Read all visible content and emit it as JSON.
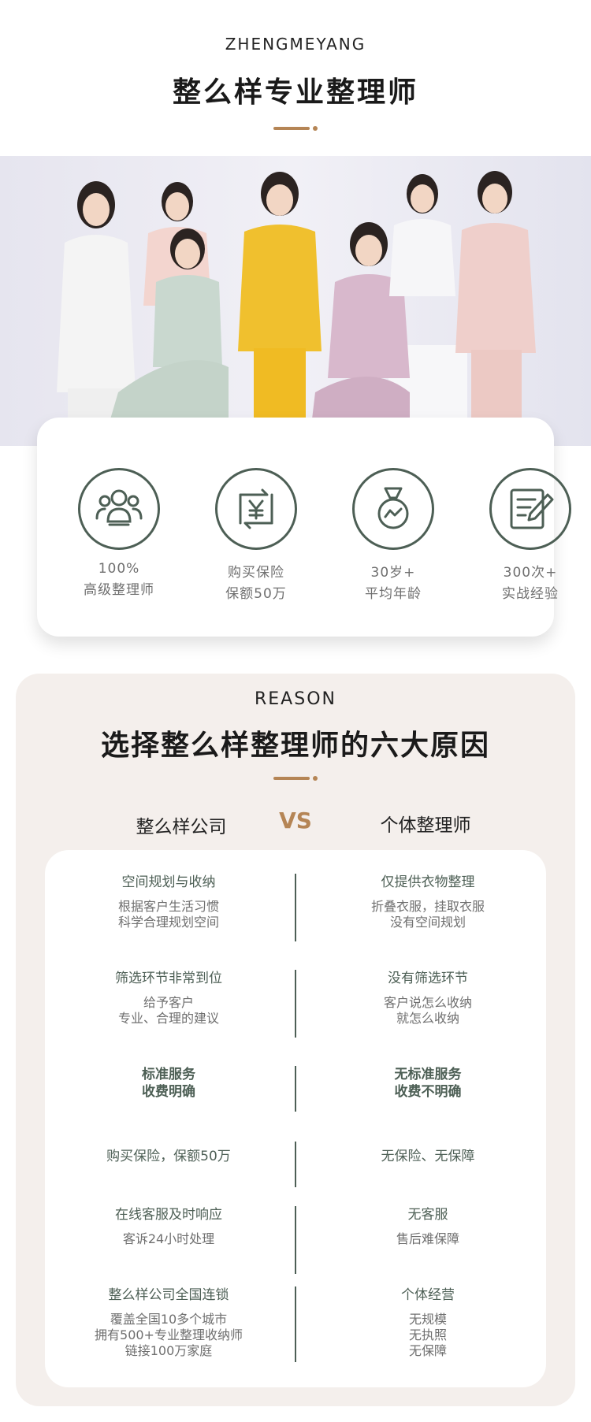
{
  "header": {
    "eyebrow": "ZHENGMEYANG",
    "title": "整么样专业整理师"
  },
  "colors": {
    "accent": "#b58555",
    "icon_green": "#4d5f55",
    "section_bg": "#f4efec"
  },
  "photo": {
    "description_icon": "team-photo"
  },
  "stats": [
    {
      "icon": "people-icon",
      "line1": "100%",
      "line2": "高级整理师"
    },
    {
      "icon": "yuan-exchange-icon",
      "line1": "购买保险",
      "line2": "保额50万"
    },
    {
      "icon": "medal-icon",
      "line1": "30岁+",
      "line2": "平均年龄"
    },
    {
      "icon": "notepad-pen-icon",
      "line1": "300次+",
      "line2": "实战经验"
    }
  ],
  "reason": {
    "eyebrow": "REASON",
    "title": "选择整么样整理师的六大原因",
    "left_label": "整么样公司",
    "vs": "VS",
    "right_label": "个体整理师",
    "rows": [
      {
        "left_title": "空间规划与收纳",
        "left_desc": [
          "根据客户生活习惯",
          "科学合理规划空间"
        ],
        "right_title": "仅提供衣物整理",
        "right_desc": [
          "折叠衣服，挂取衣服",
          "没有空间规划"
        ]
      },
      {
        "left_title": "筛选环节非常到位",
        "left_desc": [
          "给予客户",
          "专业、合理的建议"
        ],
        "right_title": "没有筛选环节",
        "right_desc": [
          "客户说怎么收纳",
          "就怎么收纳"
        ]
      },
      {
        "left_title": "标准服务",
        "left_title2": "收费明确",
        "right_title": "无标准服务",
        "right_title2": "收费不明确"
      },
      {
        "left_title": "购买保险，保额50万",
        "right_title": "无保险、无保障"
      },
      {
        "left_title": "在线客服及时响应",
        "left_desc": [
          "客诉24小时处理"
        ],
        "right_title": "无客服",
        "right_desc": [
          "售后难保障"
        ]
      },
      {
        "left_title": "整么样公司全国连锁",
        "left_desc": [
          "覆盖全国10多个城市",
          "拥有500+专业整理收纳师",
          "链接100万家庭"
        ],
        "right_title": "个体经营",
        "right_desc": [
          "无规模",
          "无执照",
          "无保障"
        ]
      }
    ]
  }
}
